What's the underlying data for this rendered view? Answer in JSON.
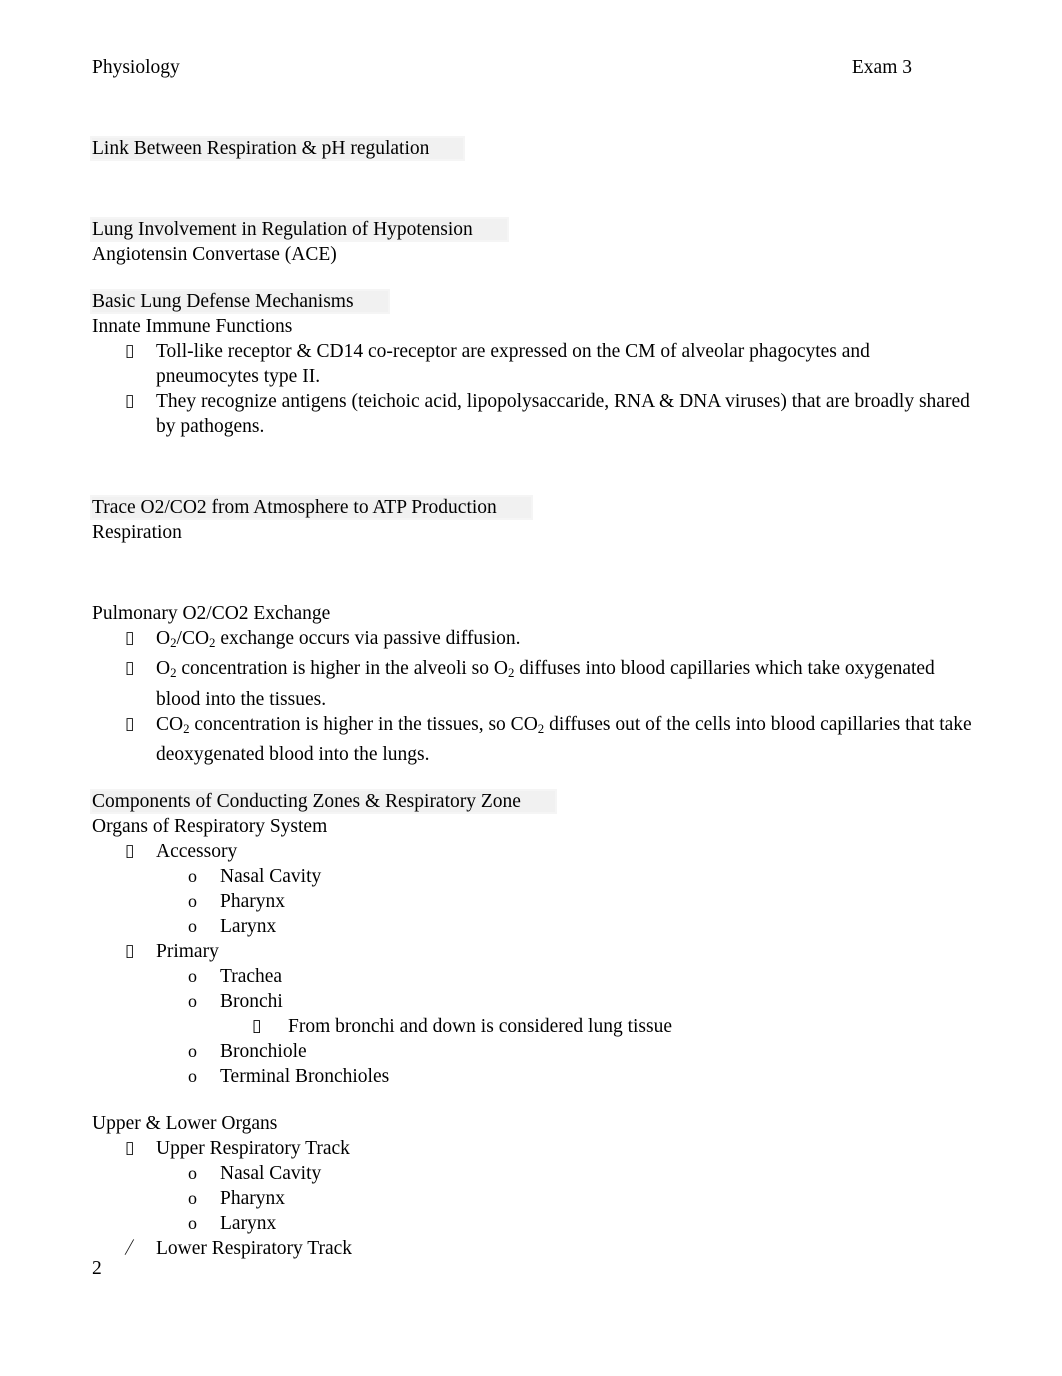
{
  "header": {
    "left": "Physiology",
    "right": "Exam 3"
  },
  "sections": [
    {
      "heading": "Link Between Respiration & pH regulation"
    },
    {
      "heading": "Lung Involvement in Regulation of Hypotension",
      "subheading": "Angiotensin Convertase (ACE)"
    },
    {
      "heading": "Basic Lung Defense Mechanisms",
      "subheading": "Innate Immune Functions",
      "bullets": [
        "Toll-like receptor & CD14 co-receptor are expressed on the CM of alveolar phagocytes and pneumocytes type II.",
        "They recognize antigens (teichoic acid, lipopolysaccaride, RNA & DNA viruses) that are broadly shared by pathogens."
      ]
    },
    {
      "heading": "Trace O2/CO2 from Atmosphere to ATP Production",
      "subheading": "Respiration"
    },
    {
      "heading": "Pulmonary O2/CO2 Exchange"
    },
    {
      "heading": "Components of Conducting Zones & Respiratory Zone",
      "subheading": "Organs of Respiratory System"
    },
    {
      "heading": "Upper & Lower Organs"
    }
  ],
  "exchange_bullets": [
    {
      "parts": [
        "O",
        "2",
        "/CO",
        "2",
        " exchange occurs via passive diffusion."
      ]
    },
    {
      "parts": [
        "O",
        "2",
        " concentration is higher in the alveoli so O",
        "2",
        " diffuses into blood capillaries which take oxygenated blood into the tissues."
      ]
    },
    {
      "parts": [
        "CO",
        "2",
        " concentration is higher in the tissues, so CO",
        "2",
        " diffuses out of the cells into blood capillaries that take deoxygenated blood into the lungs."
      ]
    }
  ],
  "organs": {
    "accessory_label": "Accessory",
    "accessory_items": [
      "Nasal Cavity",
      "Pharynx",
      "Larynx"
    ],
    "primary_label": "Primary",
    "primary_items_a": [
      "Trachea",
      "Bronchi"
    ],
    "primary_note": "From bronchi and down is considered lung tissue",
    "primary_items_b": [
      "Bronchiole",
      "Terminal Bronchioles"
    ]
  },
  "upper_lower": {
    "upper_label": "Upper Respiratory Track",
    "upper_items": [
      "Nasal Cavity",
      "Pharynx",
      "Larynx"
    ],
    "lower_label": "Lower Respiratory Track"
  },
  "bullet_glyphs": {
    "square": "▯",
    "circle": "o",
    "slash": "⧸"
  },
  "page_number": "2"
}
